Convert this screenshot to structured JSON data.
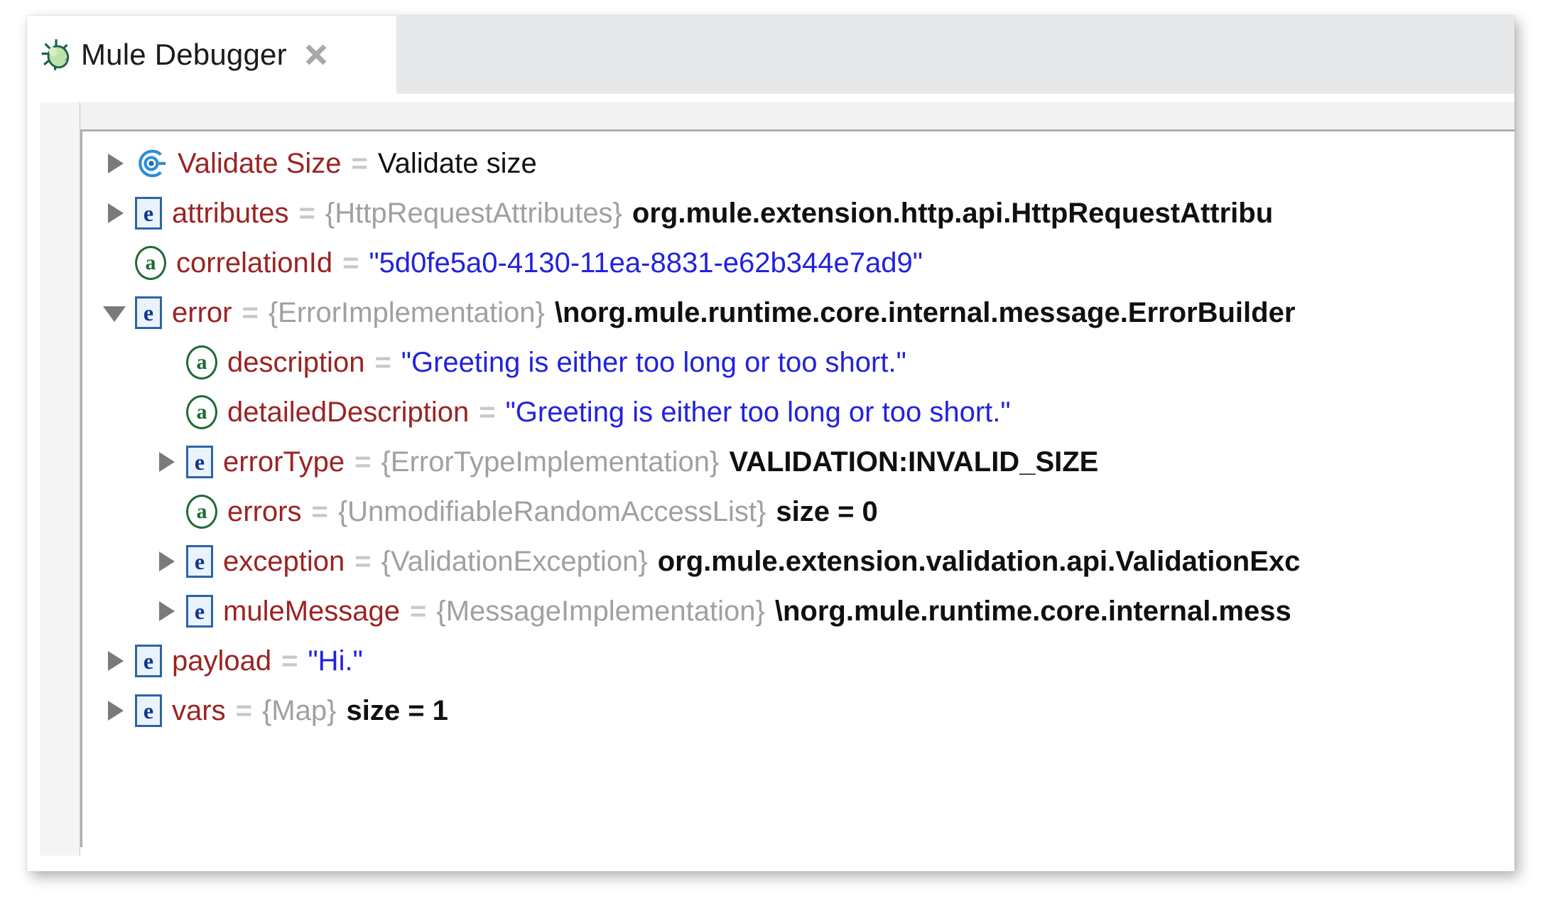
{
  "window": {
    "tab": {
      "title": "Mule Debugger",
      "icon": "bug-icon",
      "close_icon": "close-icon"
    }
  },
  "colors": {
    "name": "#9b2323",
    "type": "#a0a0a0",
    "string_value": "#2222dd",
    "value": "#101010",
    "equals": "#c8c8c8",
    "icon_e_border": "#2d64a8",
    "icon_a_border": "#1d6b33",
    "tabbar_bg": "#e6e8e9",
    "panel_bg": "#ffffff"
  },
  "tree": {
    "rows": [
      {
        "indent": 0,
        "twisty": "closed",
        "icon": "component-icon",
        "name": "Validate Size",
        "eq": "=",
        "type": "",
        "value": "Validate size",
        "value_kind": "plain"
      },
      {
        "indent": 0,
        "twisty": "closed",
        "icon": "e-icon",
        "name": "attributes",
        "eq": "=",
        "type": "{HttpRequestAttributes}",
        "value": "org.mule.extension.http.api.HttpRequestAttribu",
        "value_kind": "dark"
      },
      {
        "indent": 0,
        "twisty": "none",
        "icon": "a-icon",
        "name": "correlationId",
        "eq": "=",
        "type": "",
        "value": "\"5d0fe5a0-4130-11ea-8831-e62b344e7ad9\"",
        "value_kind": "string"
      },
      {
        "indent": 0,
        "twisty": "open",
        "icon": "e-icon",
        "name": "error",
        "eq": "=",
        "type": "{ErrorImplementation}",
        "value": "\\norg.mule.runtime.core.internal.message.ErrorBuilder",
        "value_kind": "dark"
      },
      {
        "indent": 1,
        "twisty": "none",
        "icon": "a-icon",
        "name": "description",
        "eq": "=",
        "type": "",
        "value": "\"Greeting is either too long or too short.\"",
        "value_kind": "string"
      },
      {
        "indent": 1,
        "twisty": "none",
        "icon": "a-icon",
        "name": "detailedDescription",
        "eq": "=",
        "type": "",
        "value": "\"Greeting is either too long or too short.\"",
        "value_kind": "string"
      },
      {
        "indent": 1,
        "twisty": "closed",
        "icon": "e-icon",
        "name": "errorType",
        "eq": "=",
        "type": "{ErrorTypeImplementation}",
        "value": "VALIDATION:INVALID_SIZE",
        "value_kind": "dark"
      },
      {
        "indent": 1,
        "twisty": "none",
        "icon": "a-icon",
        "name": "errors",
        "eq": "=",
        "type": "{UnmodifiableRandomAccessList}",
        "value": "size = 0",
        "value_kind": "dark"
      },
      {
        "indent": 1,
        "twisty": "closed",
        "icon": "e-icon",
        "name": "exception",
        "eq": "=",
        "type": "{ValidationException}",
        "value": "org.mule.extension.validation.api.ValidationExc",
        "value_kind": "dark"
      },
      {
        "indent": 1,
        "twisty": "closed",
        "icon": "e-icon",
        "name": "muleMessage",
        "eq": "=",
        "type": "{MessageImplementation}",
        "value": "\\norg.mule.runtime.core.internal.mess",
        "value_kind": "dark"
      },
      {
        "indent": 0,
        "twisty": "closed",
        "icon": "e-icon",
        "name": "payload",
        "eq": "=",
        "type": "",
        "value": "\"Hi.\"",
        "value_kind": "string"
      },
      {
        "indent": 0,
        "twisty": "closed",
        "icon": "e-icon",
        "name": "vars",
        "eq": "=",
        "type": "{Map}",
        "value": "size = 1",
        "value_kind": "dark"
      }
    ]
  }
}
